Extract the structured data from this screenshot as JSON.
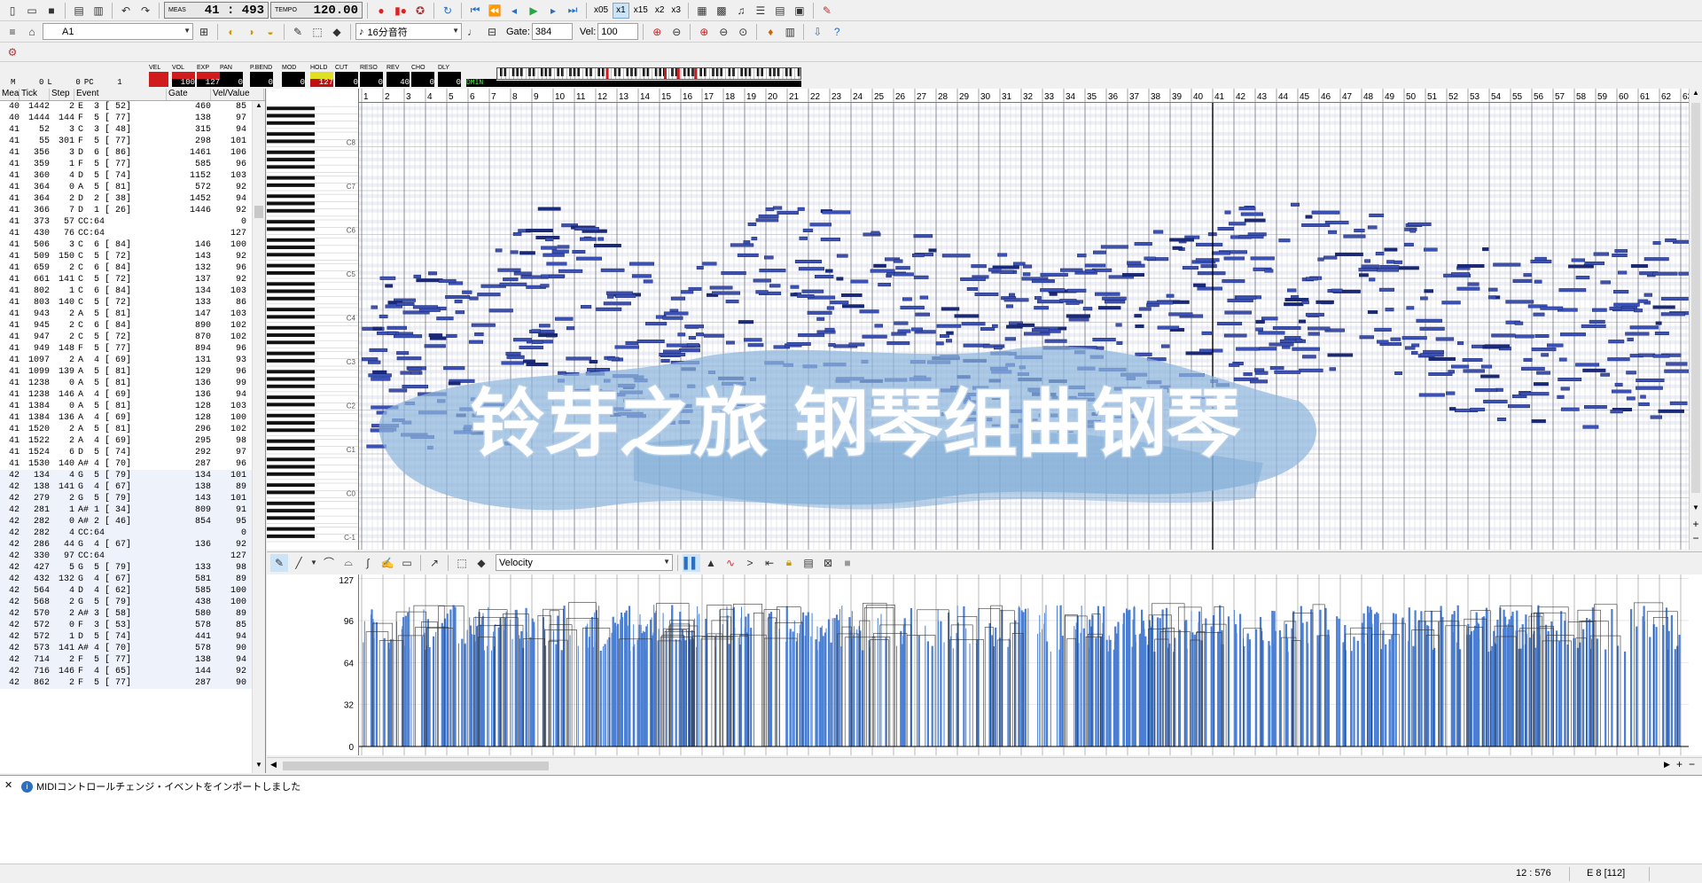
{
  "toolbar": {
    "meas_label": "MEAS",
    "meas_value": "41 : 493",
    "tempo_label": "TEMPO",
    "tempo_value": "120.00",
    "speeds": [
      "x05",
      "x1",
      "x15",
      "x2",
      "x3"
    ],
    "active_speed": "x1",
    "track_name": "A1",
    "note_length": "16分音符",
    "gate_label": "Gate:",
    "gate_value": "384",
    "vel_label": "Vel:",
    "vel_value": "100"
  },
  "mixer": {
    "m_label": "M",
    "m_value": "0",
    "l_label": "L",
    "l_value": "0",
    "pc_label": "PC",
    "pc_value": "1",
    "channels": [
      {
        "label": "VEL",
        "value": ""
      },
      {
        "label": "VOL",
        "value": "100"
      },
      {
        "label": "EXP",
        "value": "127"
      },
      {
        "label": "PAN",
        "value": "0"
      },
      {
        "label": "P.BEND",
        "value": "0"
      },
      {
        "label": "MOD",
        "value": "0"
      },
      {
        "label": "HOLD",
        "value": "127"
      },
      {
        "label": "CUT",
        "value": "0"
      },
      {
        "label": "RESO",
        "value": "0"
      },
      {
        "label": "REV",
        "value": "40"
      },
      {
        "label": "CHO",
        "value": "0"
      },
      {
        "label": "DLY",
        "value": "0"
      }
    ],
    "key_readout": "DMIN"
  },
  "event_list": {
    "headers": [
      "Mea",
      "Tick",
      "Step",
      "Event",
      "Gate",
      "Vel/Value"
    ],
    "rows": [
      [
        "40",
        "1442",
        "2",
        "E  3 [ 52]",
        "460",
        "85"
      ],
      [
        "40",
        "1444",
        "144",
        "F  5 [ 77]",
        "138",
        "97"
      ],
      [
        "41",
        "52",
        "3",
        "C  3 [ 48]",
        "315",
        "94"
      ],
      [
        "41",
        "55",
        "301",
        "F  5 [ 77]",
        "298",
        "101"
      ],
      [
        "41",
        "356",
        "3",
        "D  6 [ 86]",
        "1461",
        "106"
      ],
      [
        "41",
        "359",
        "1",
        "F  5 [ 77]",
        "585",
        "96"
      ],
      [
        "41",
        "360",
        "4",
        "D  5 [ 74]",
        "1152",
        "103"
      ],
      [
        "41",
        "364",
        "0",
        "A  5 [ 81]",
        "572",
        "92"
      ],
      [
        "41",
        "364",
        "2",
        "D  2 [ 38]",
        "1452",
        "94"
      ],
      [
        "41",
        "366",
        "7",
        "D  1 [ 26]",
        "1446",
        "92"
      ],
      [
        "41",
        "373",
        "57",
        "CC:64",
        "",
        "0"
      ],
      [
        "41",
        "430",
        "76",
        "CC:64",
        "",
        "127"
      ],
      [
        "41",
        "506",
        "3",
        "C  6 [ 84]",
        "146",
        "100"
      ],
      [
        "41",
        "509",
        "150",
        "C  5 [ 72]",
        "143",
        "92"
      ],
      [
        "41",
        "659",
        "2",
        "C  6 [ 84]",
        "132",
        "96"
      ],
      [
        "41",
        "661",
        "141",
        "C  5 [ 72]",
        "137",
        "92"
      ],
      [
        "41",
        "802",
        "1",
        "C  6 [ 84]",
        "134",
        "103"
      ],
      [
        "41",
        "803",
        "140",
        "C  5 [ 72]",
        "133",
        "86"
      ],
      [
        "41",
        "943",
        "2",
        "A  5 [ 81]",
        "147",
        "103"
      ],
      [
        "41",
        "945",
        "2",
        "C  6 [ 84]",
        "890",
        "102"
      ],
      [
        "41",
        "947",
        "2",
        "C  5 [ 72]",
        "870",
        "102"
      ],
      [
        "41",
        "949",
        "148",
        "F  5 [ 77]",
        "894",
        "96"
      ],
      [
        "41",
        "1097",
        "2",
        "A  4 [ 69]",
        "131",
        "93"
      ],
      [
        "41",
        "1099",
        "139",
        "A  5 [ 81]",
        "129",
        "96"
      ],
      [
        "41",
        "1238",
        "0",
        "A  5 [ 81]",
        "136",
        "99"
      ],
      [
        "41",
        "1238",
        "146",
        "A  4 [ 69]",
        "136",
        "94"
      ],
      [
        "41",
        "1384",
        "0",
        "A  5 [ 81]",
        "128",
        "103"
      ],
      [
        "41",
        "1384",
        "136",
        "A  4 [ 69]",
        "128",
        "100"
      ],
      [
        "41",
        "1520",
        "2",
        "A  5 [ 81]",
        "296",
        "102"
      ],
      [
        "41",
        "1522",
        "2",
        "A  4 [ 69]",
        "295",
        "98"
      ],
      [
        "41",
        "1524",
        "6",
        "D  5 [ 74]",
        "292",
        "97"
      ],
      [
        "41",
        "1530",
        "140",
        "A# 4 [ 70]",
        "287",
        "96"
      ],
      [
        "42",
        "134",
        "4",
        "G  5 [ 79]",
        "134",
        "101"
      ],
      [
        "42",
        "138",
        "141",
        "G  4 [ 67]",
        "138",
        "89"
      ],
      [
        "42",
        "279",
        "2",
        "G  5 [ 79]",
        "143",
        "101"
      ],
      [
        "42",
        "281",
        "1",
        "A# 1 [ 34]",
        "809",
        "91"
      ],
      [
        "42",
        "282",
        "0",
        "A# 2 [ 46]",
        "854",
        "95"
      ],
      [
        "42",
        "282",
        "4",
        "CC:64",
        "",
        "0"
      ],
      [
        "42",
        "286",
        "44",
        "G  4 [ 67]",
        "136",
        "92"
      ],
      [
        "42",
        "330",
        "97",
        "CC:64",
        "",
        "127"
      ],
      [
        "42",
        "427",
        "5",
        "G  5 [ 79]",
        "133",
        "98"
      ],
      [
        "42",
        "432",
        "132",
        "G  4 [ 67]",
        "581",
        "89"
      ],
      [
        "42",
        "564",
        "4",
        "D  4 [ 62]",
        "585",
        "100"
      ],
      [
        "42",
        "568",
        "2",
        "G  5 [ 79]",
        "438",
        "100"
      ],
      [
        "42",
        "570",
        "2",
        "A# 3 [ 58]",
        "580",
        "89"
      ],
      [
        "42",
        "572",
        "0",
        "F  3 [ 53]",
        "578",
        "85"
      ],
      [
        "42",
        "572",
        "1",
        "D  5 [ 74]",
        "441",
        "94"
      ],
      [
        "42",
        "573",
        "141",
        "A# 4 [ 70]",
        "578",
        "90"
      ],
      [
        "42",
        "714",
        "2",
        "F  5 [ 77]",
        "138",
        "94"
      ],
      [
        "42",
        "716",
        "146",
        "F  4 [ 65]",
        "144",
        "92"
      ],
      [
        "42",
        "862",
        "2",
        "F  5 [ 77]",
        "287",
        "90"
      ]
    ]
  },
  "piano_roll": {
    "measure_start": 1,
    "measure_end": 63,
    "octave_labels": [
      "C8",
      "C7",
      "C6",
      "C5",
      "C4",
      "C3",
      "C2",
      "C1",
      "C0",
      "C-1"
    ],
    "cursor_measure": 41
  },
  "controller": {
    "type_select": "Velocity",
    "axis_ticks": [
      "127",
      "96",
      "64",
      "32",
      "0"
    ]
  },
  "watermark": {
    "text": "铃芽之旅 钢琴组曲钢琴"
  },
  "message_panel": {
    "close_label": "✕",
    "message": "MIDIコントロールチェンジ・イベントをインポートしました"
  },
  "status": {
    "position": "12 : 576",
    "note": "E  8 [112]"
  }
}
